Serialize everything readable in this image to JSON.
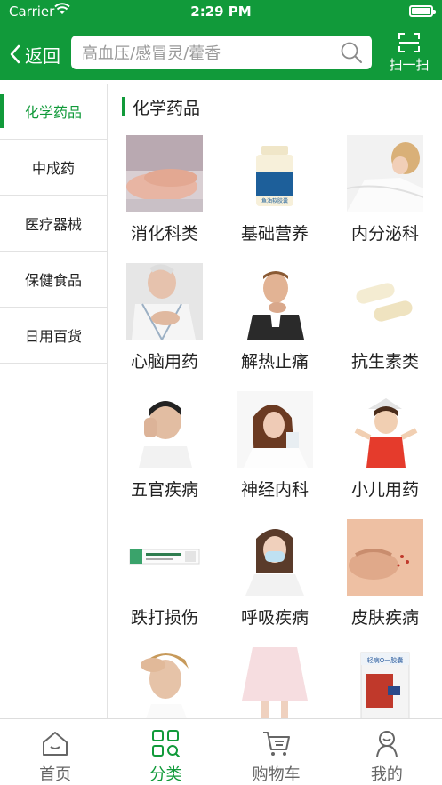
{
  "status_bar": {
    "carrier": "Carrier",
    "time": "2:29 PM"
  },
  "nav": {
    "back_label": "返回",
    "scan_label": "扫一扫"
  },
  "search": {
    "placeholder": "高血压/感冒灵/藿香"
  },
  "sidebar": {
    "items": [
      {
        "label": "化学药品",
        "active": true
      },
      {
        "label": "中成药"
      },
      {
        "label": "医疗器械"
      },
      {
        "label": "保健食品"
      },
      {
        "label": "日用百货"
      }
    ]
  },
  "section": {
    "title": "化学药品"
  },
  "categories": [
    {
      "label": "消化科类",
      "icon": "stomach-photo"
    },
    {
      "label": "基础营养",
      "icon": "supplement-bottle-photo",
      "bottle_text": "鱼油软胶囊"
    },
    {
      "label": "内分泌科",
      "icon": "reclining-woman-photo"
    },
    {
      "label": "心脑用药",
      "icon": "chest-pain-man-photo"
    },
    {
      "label": "解热止痛",
      "icon": "sore-throat-man-photo"
    },
    {
      "label": "抗生素类",
      "icon": "capsules-photo"
    },
    {
      "label": "五官疾病",
      "icon": "headache-boy-photo"
    },
    {
      "label": "神经内科",
      "icon": "tired-woman-photo"
    },
    {
      "label": "小儿用药",
      "icon": "child-photo"
    },
    {
      "label": "跌打损伤",
      "icon": "medicine-box-photo"
    },
    {
      "label": "呼吸疾病",
      "icon": "masked-woman-photo"
    },
    {
      "label": "皮肤疾病",
      "icon": "skin-rash-photo"
    },
    {
      "label": "",
      "icon": "headache-man-photo"
    },
    {
      "label": "",
      "icon": "skirt-photo"
    },
    {
      "label": "",
      "icon": "medicine-package-photo",
      "box_text": "轻病O一胶囊"
    }
  ],
  "tabbar": {
    "items": [
      {
        "label": "首页",
        "icon": "home-icon"
      },
      {
        "label": "分类",
        "icon": "category-icon",
        "active": true
      },
      {
        "label": "购物车",
        "icon": "cart-icon"
      },
      {
        "label": "我的",
        "icon": "profile-icon"
      }
    ]
  },
  "colors": {
    "brand": "#119a3a",
    "text": "#222222",
    "muted": "#9a9a9a"
  }
}
